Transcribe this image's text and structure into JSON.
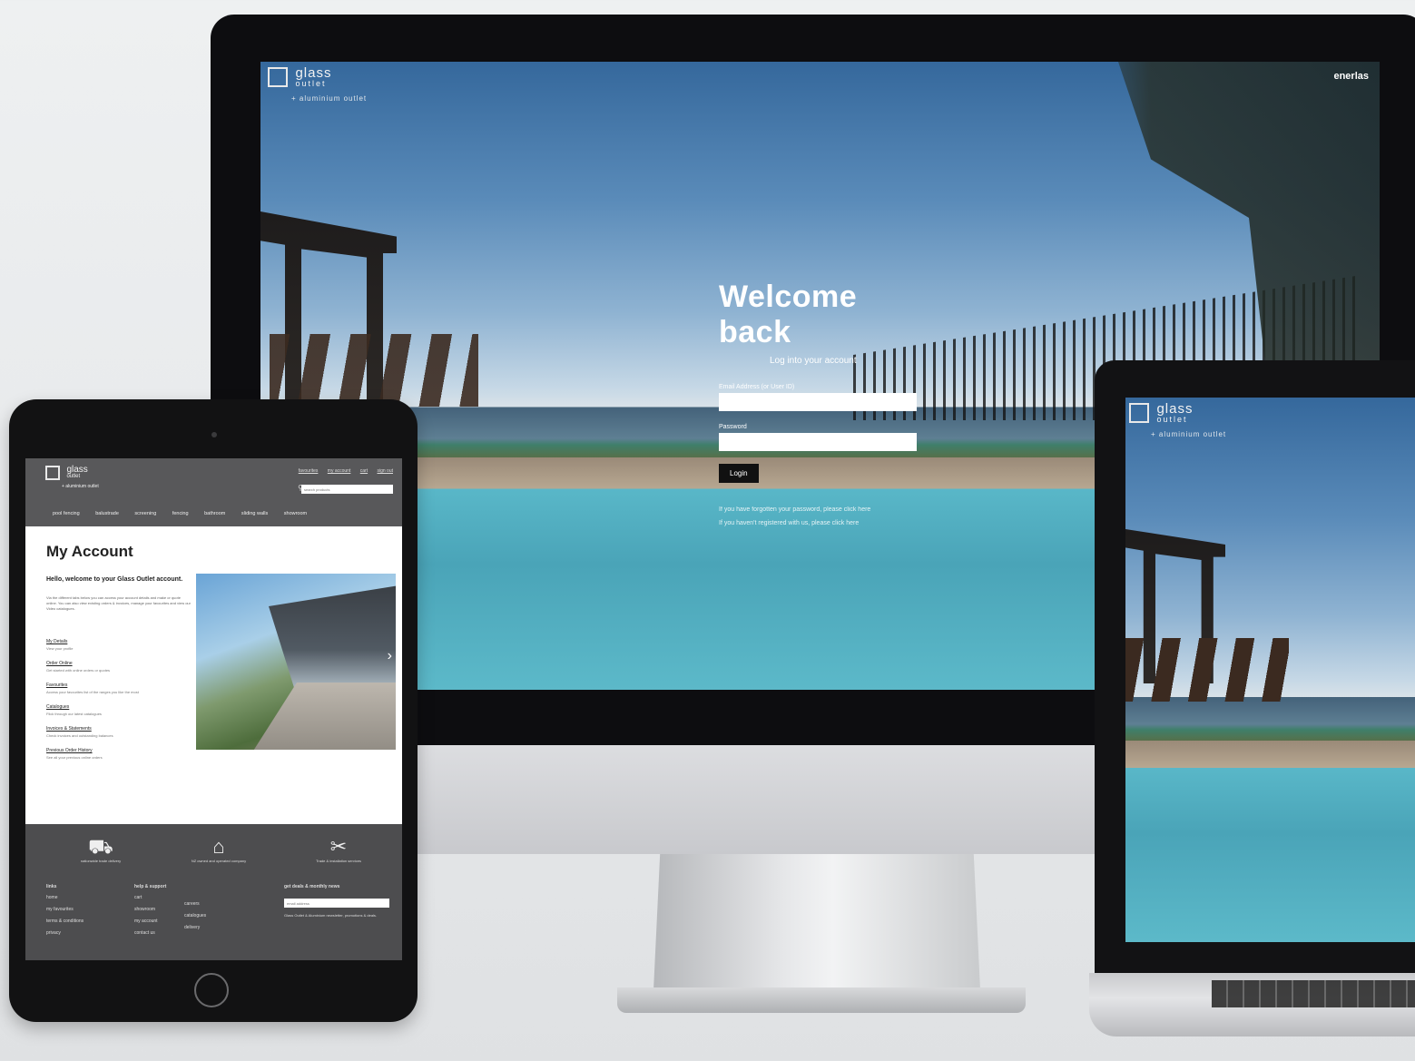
{
  "brand": {
    "logo_line1": "glass",
    "logo_line2": "outlet",
    "logo_tagline": "+ aluminium outlet"
  },
  "desktop": {
    "corner_link": "enerlas",
    "welcome_title": "Welcome back",
    "welcome_sub": "Log into your account",
    "email_label": "Email Address (or User ID)",
    "password_label": "Password",
    "login_button": "Login",
    "help_line1": "If you have forgotten your password, please click here",
    "help_line2": "If you haven't registered with us, please click here"
  },
  "tablet": {
    "top_links": [
      "favourites",
      "my account",
      "cart",
      "sign out"
    ],
    "search_placeholder": "search products",
    "nav": [
      "pool fencing",
      "balustrade",
      "screening",
      "fencing",
      "bathroom",
      "sliding walls",
      "showroom"
    ],
    "page_title": "My Account",
    "hello_text": "Hello, welcome to your Glass Outlet account.",
    "intro_text": "Via the different tabs below you can access your account details and make or quote online. You can also view existing orders & invoices, manage your favourites and view our Video catalogues.",
    "account_items": [
      {
        "link": "My Details",
        "desc": "View your profile"
      },
      {
        "link": "Order Online",
        "desc": "Get started with online orders or quotes"
      },
      {
        "link": "Favourites",
        "desc": "Access your favourites list of the ranges you like the most"
      },
      {
        "link": "Catalogues",
        "desc": "Flick through our latest catalogues"
      },
      {
        "link": "Invoices & Statements",
        "desc": "Check invoices and outstanding balances"
      },
      {
        "link": "Previous Order History",
        "desc": "See all your previous online orders"
      }
    ],
    "services": [
      {
        "icon": "truck-icon",
        "glyph": "⛟",
        "label": "nationwide trade delivery"
      },
      {
        "icon": "house-icon",
        "glyph": "⌂",
        "label": "NZ owned and operated company"
      },
      {
        "icon": "tools-icon",
        "glyph": "✂",
        "label": "Trade & installation services"
      }
    ],
    "footer_col1": {
      "heading": "links",
      "items": [
        "home",
        "my favourites",
        "terms & conditions",
        "privacy"
      ]
    },
    "footer_col2": {
      "heading": "help & support",
      "items": [
        "cart",
        "showroom",
        "my account",
        "contact us"
      ]
    },
    "footer_col3": {
      "items": [
        "careers",
        "catalogues",
        "delivery"
      ]
    },
    "newsletter": {
      "heading": "get deals & monthly news",
      "placeholder": "email address",
      "blurb": "Glass Outlet & Aluminium newsletter, promotions & deals."
    }
  },
  "colors": {
    "tablet_header": "#58585a",
    "tablet_footer": "#4d4d4f",
    "device_black": "#0d0d10"
  }
}
